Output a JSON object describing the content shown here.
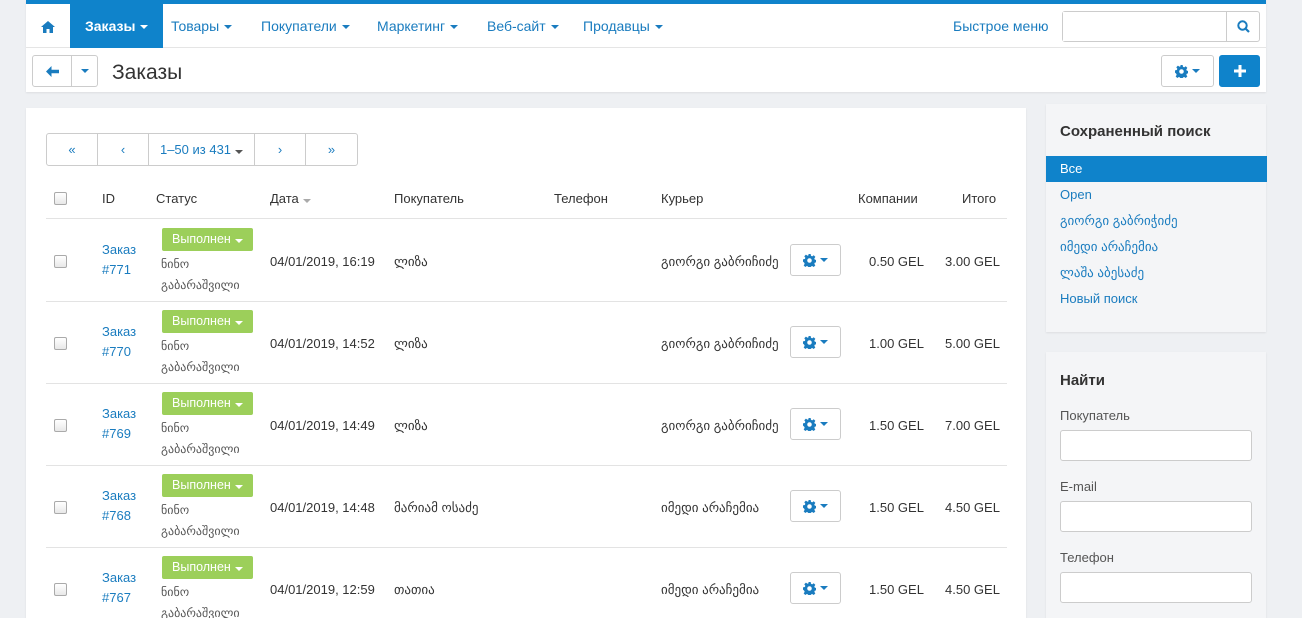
{
  "nav": {
    "home_icon": "home-icon",
    "items": [
      {
        "label": "Заказы",
        "active": true
      },
      {
        "label": "Товары"
      },
      {
        "label": "Покупатели"
      },
      {
        "label": "Маркетинг"
      },
      {
        "label": "Веб-сайт"
      },
      {
        "label": "Продавцы"
      }
    ],
    "quick_menu": "Быстрое меню",
    "search_placeholder": "",
    "accent": "#0f83cb"
  },
  "page": {
    "title": "Заказы"
  },
  "pager": {
    "first": "«",
    "prev": "‹",
    "range": "1–50 из 431",
    "next": "›",
    "last": "»"
  },
  "table": {
    "headers": {
      "id": "ID",
      "status": "Статус",
      "date": "Дата",
      "customer": "Покупатель",
      "phone": "Телефон",
      "courier": "Курьер",
      "company": "Компании",
      "total": "Итого"
    },
    "rows": [
      {
        "order": "Заказ",
        "num": "#771",
        "status": "Выполнен",
        "status_user": "ნინო გაბარაშვილი",
        "date": "04/01/2019, 16:19",
        "customer": "ლიზა",
        "phone": "",
        "courier": "გიორგი გაბრიჩიძე",
        "company": "0.50 GEL",
        "total": "3.00 GEL"
      },
      {
        "order": "Заказ",
        "num": "#770",
        "status": "Выполнен",
        "status_user": "ნინო გაბარაშვილი",
        "date": "04/01/2019, 14:52",
        "customer": "ლიზა",
        "phone": "",
        "courier": "გიორგი გაბრიჩიძე",
        "company": "1.00 GEL",
        "total": "5.00 GEL"
      },
      {
        "order": "Заказ",
        "num": "#769",
        "status": "Выполнен",
        "status_user": "ნინო გაბარაშვილი",
        "date": "04/01/2019, 14:49",
        "customer": "ლიზა",
        "phone": "",
        "courier": "გიორგი გაბრიჩიძე",
        "company": "1.50 GEL",
        "total": "7.00 GEL"
      },
      {
        "order": "Заказ",
        "num": "#768",
        "status": "Выполнен",
        "status_user": "ნინო გაბარაშვილი",
        "date": "04/01/2019, 14:48",
        "customer": "მარიამ ოსაძე",
        "phone": "",
        "courier": "იმედი არაჩემია",
        "company": "1.50 GEL",
        "total": "4.50 GEL"
      },
      {
        "order": "Заказ",
        "num": "#767",
        "status": "Выполнен",
        "status_user": "ნინო გაბარაშვილი",
        "date": "04/01/2019, 12:59",
        "customer": "თათია",
        "phone": "",
        "courier": "იმედი არაჩემია",
        "company": "1.50 GEL",
        "total": "4.50 GEL"
      }
    ],
    "status_color": "#9ccf5a"
  },
  "saved_search": {
    "title": "Сохраненный поиск",
    "items": [
      {
        "label": "Все",
        "active": true
      },
      {
        "label": "Open"
      },
      {
        "label": "გიორგი გაბრიჭიძე"
      },
      {
        "label": "იმედი არაჩემია"
      },
      {
        "label": "ლაშა აბესაძე"
      },
      {
        "label": "Новый поиск"
      }
    ]
  },
  "find": {
    "title": "Найти",
    "customer_label": "Покупатель",
    "email_label": "E-mail",
    "phone_label": "Телефон"
  }
}
